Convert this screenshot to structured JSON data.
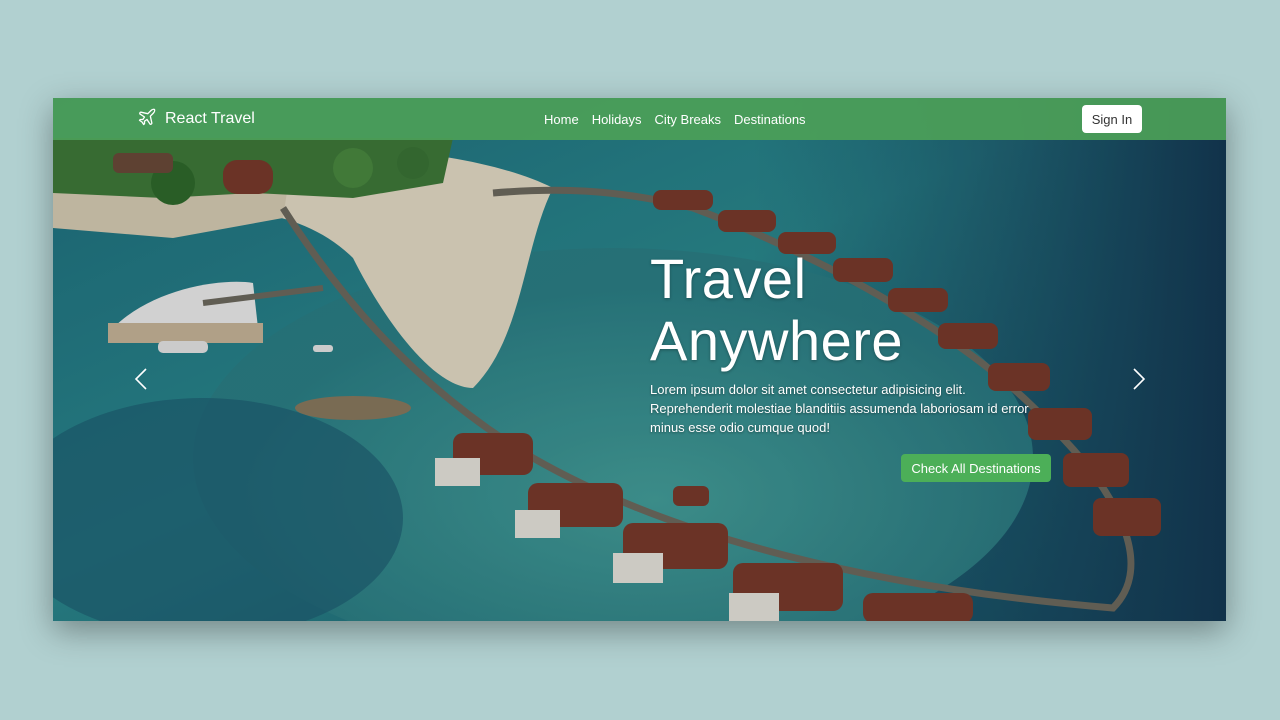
{
  "brand": {
    "name": "React Travel",
    "icon": "airplane-icon"
  },
  "nav": {
    "links": [
      "Home",
      "Holidays",
      "City Breaks",
      "Destinations"
    ],
    "sign_in_label": "Sign In"
  },
  "hero": {
    "title_line1": "Travel",
    "title_line2": "Anywhere",
    "description": "Lorem ipsum dolor sit amet consectetur adipisicing elit. Reprehenderit molestiae blanditiis assumenda laboriosam id error minus esse odio cumque quod!",
    "cta_label": "Check All Destinations",
    "background_image": "aerial-resort-island-overwater-villas"
  },
  "carousel": {
    "prev_icon": "chevron-left-icon",
    "next_icon": "chevron-right-icon"
  },
  "colors": {
    "page_background": "#b1d0d0",
    "navbar": "#4ca058",
    "accent": "#4caf58",
    "text_light": "#ffffff"
  }
}
